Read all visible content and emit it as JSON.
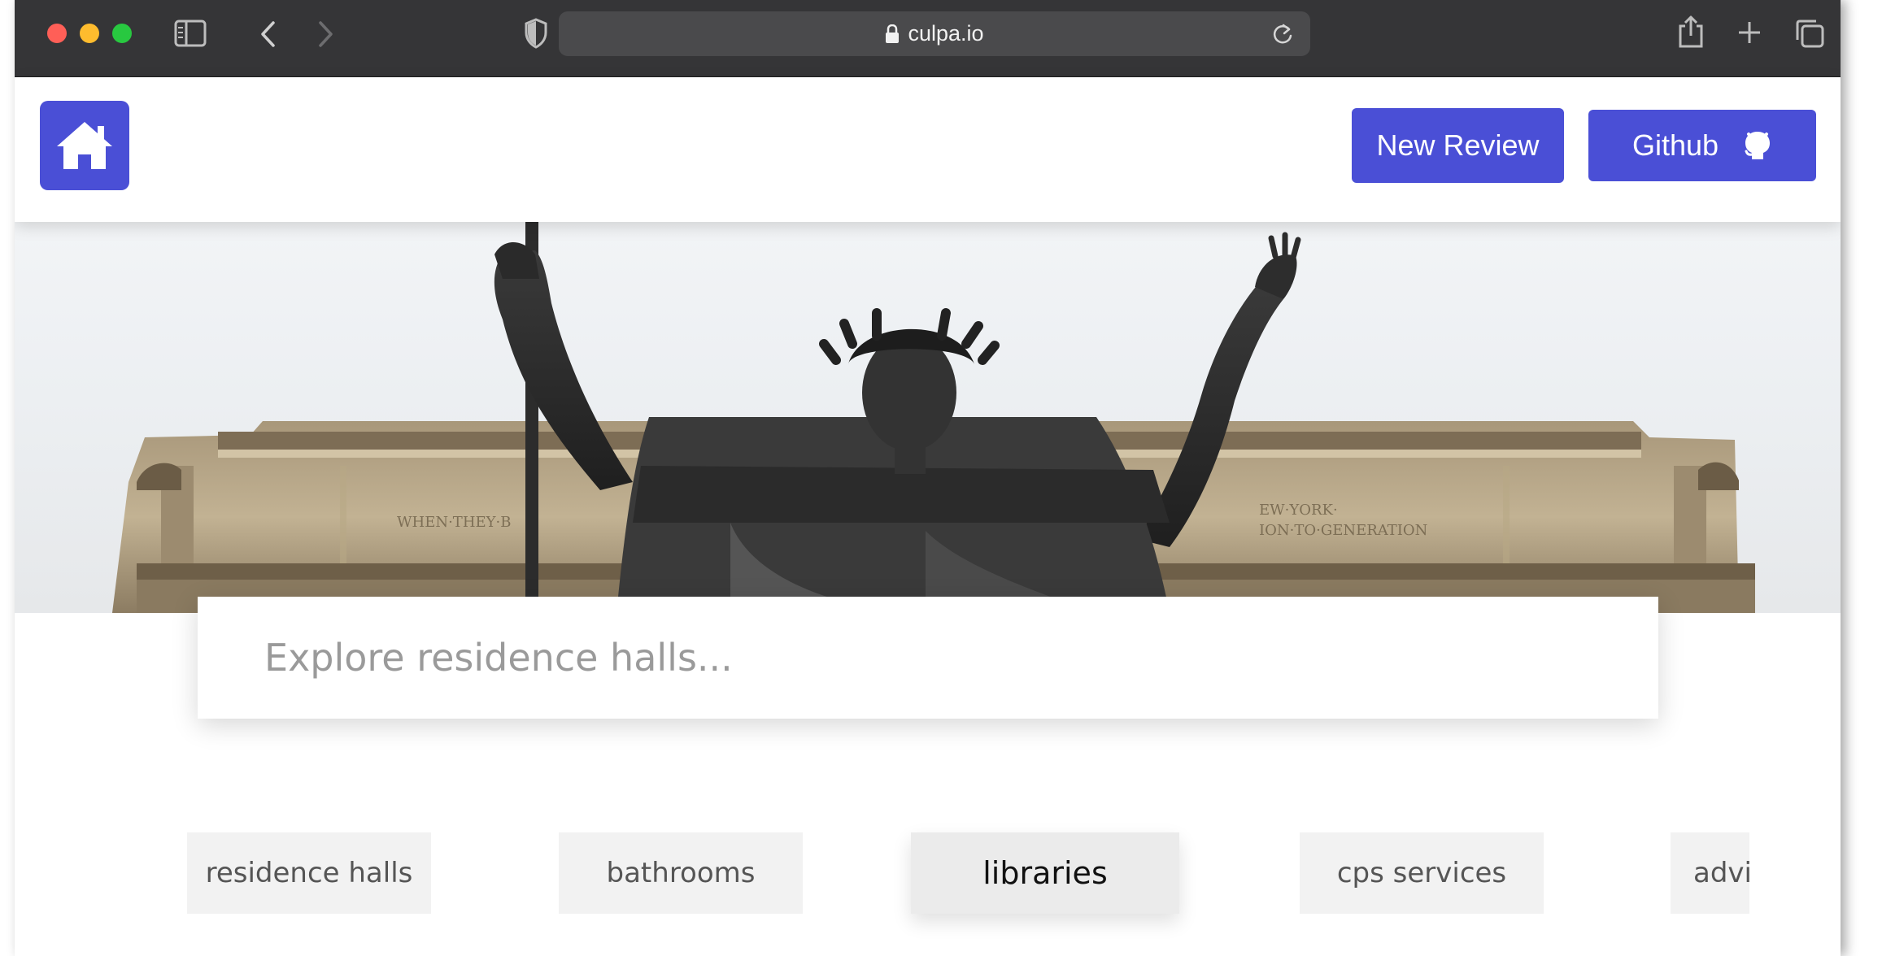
{
  "browser": {
    "url": "culpa.io",
    "icons": {
      "sidebar": "sidebar-icon",
      "back": "chevron-left-icon",
      "forward": "chevron-right-icon",
      "privacy": "shield-icon",
      "lock": "lock-icon",
      "reload": "reload-icon",
      "share": "share-icon",
      "new_tab": "plus-icon",
      "tabs": "tabs-overview-icon"
    }
  },
  "header": {
    "home_icon": "house-icon",
    "new_review_label": "New Review",
    "github_label": "Github",
    "github_icon": "github-icon"
  },
  "search": {
    "placeholder": "Explore residence halls..."
  },
  "categories": [
    {
      "label": "residence halls",
      "active": false
    },
    {
      "label": "bathrooms",
      "active": false
    },
    {
      "label": "libraries",
      "active": true
    },
    {
      "label": "cps services",
      "active": false
    },
    {
      "label": "advi",
      "active": false
    }
  ],
  "colors": {
    "accent": "#4a4fd6",
    "toolbar": "#353537",
    "chip_bg": "#f2f2f2"
  }
}
